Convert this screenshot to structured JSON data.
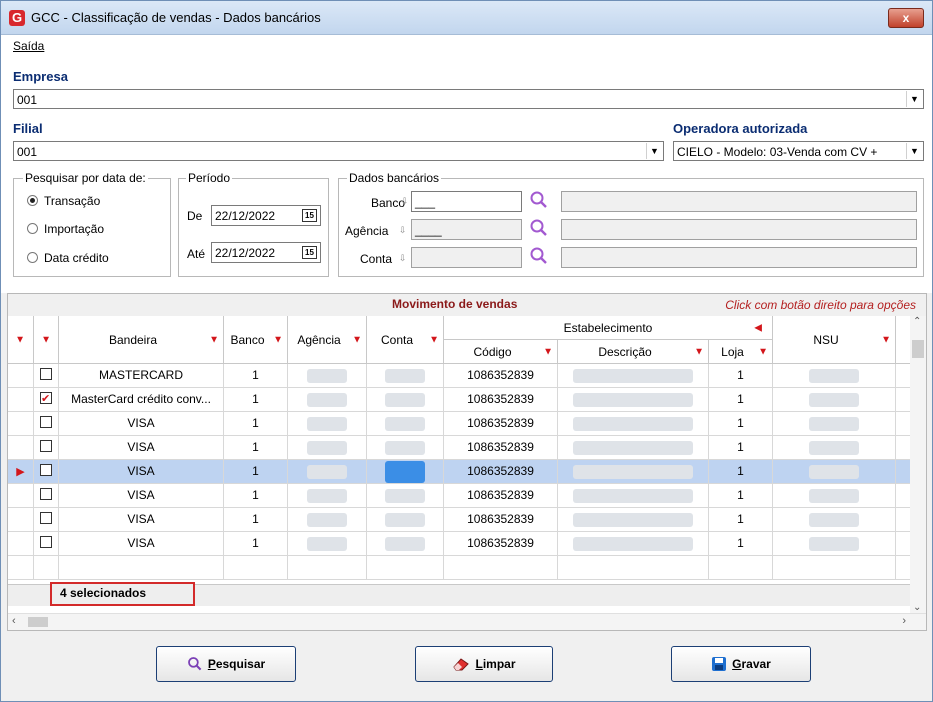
{
  "window": {
    "title": "GCC - Classificação de vendas - Dados bancários",
    "close": "x",
    "icon": "G"
  },
  "menu": {
    "items": [
      {
        "label": "Saída"
      }
    ]
  },
  "empresa": {
    "label": "Empresa",
    "value": "001"
  },
  "filial": {
    "label": "Filial",
    "value": "001"
  },
  "operadora": {
    "label": "Operadora autorizada",
    "value": "CIELO - Modelo: 03-Venda com CV +"
  },
  "pesquisar": {
    "label": "Pesquisar por data de:",
    "options": [
      "Transação",
      "Importação",
      "Data crédito"
    ],
    "selected": "Transação"
  },
  "periodo": {
    "label": "Período",
    "de_label": "De",
    "de_value": "22/12/2022",
    "ate_label": "Até",
    "ate_value": "22/12/2022",
    "cal_icon": "15"
  },
  "dados_bancarios": {
    "label": "Dados bancários",
    "banco_label": "Banco",
    "banco_value": "___",
    "agencia_label": "Agência",
    "agencia_value": "____",
    "conta_label": "Conta"
  },
  "grid": {
    "caption": "Movimento de vendas",
    "hint": "Click com botão direito para opções",
    "group_header": "Estabelecimento",
    "columns": [
      "Bandeira",
      "Banco",
      "Agência",
      "Conta",
      "Código",
      "Descrição",
      "Loja",
      "NSU"
    ],
    "rows": [
      {
        "checked": false,
        "bandeira": "MASTERCARD",
        "banco": "1",
        "codigo": "1086352839",
        "loja": "1",
        "selected": false
      },
      {
        "checked": true,
        "bandeira": "MasterCard crédito conv...",
        "banco": "1",
        "codigo": "1086352839",
        "loja": "1",
        "selected": false
      },
      {
        "checked": false,
        "bandeira": "VISA",
        "banco": "1",
        "codigo": "1086352839",
        "loja": "1",
        "selected": false
      },
      {
        "checked": false,
        "bandeira": "VISA",
        "banco": "1",
        "codigo": "1086352839",
        "loja": "1",
        "selected": false
      },
      {
        "checked": false,
        "bandeira": "VISA",
        "banco": "1",
        "codigo": "1086352839",
        "loja": "1",
        "selected": true
      },
      {
        "checked": false,
        "bandeira": "VISA",
        "banco": "1",
        "codigo": "1086352839",
        "loja": "1",
        "selected": false
      },
      {
        "checked": false,
        "bandeira": "VISA",
        "banco": "1",
        "codigo": "1086352839",
        "loja": "1",
        "selected": false
      },
      {
        "checked": false,
        "bandeira": "VISA",
        "banco": "1",
        "codigo": "1086352839",
        "loja": "1",
        "selected": false
      }
    ],
    "selected_count": "4 selecionados"
  },
  "buttons": {
    "pesquisar": {
      "accel": "P",
      "rest": "esquisar",
      "icon": "search-icon"
    },
    "limpar": {
      "accel": "L",
      "rest": "impar",
      "icon": "eraser-icon"
    },
    "gravar": {
      "accel": "G",
      "rest": "ravar",
      "icon": "save-icon"
    }
  },
  "colors": {
    "accent_label": "#0b2d72",
    "filter_icon": "#d3161b",
    "selection": "#bed3f1",
    "highlight_border": "#d32a2a"
  }
}
